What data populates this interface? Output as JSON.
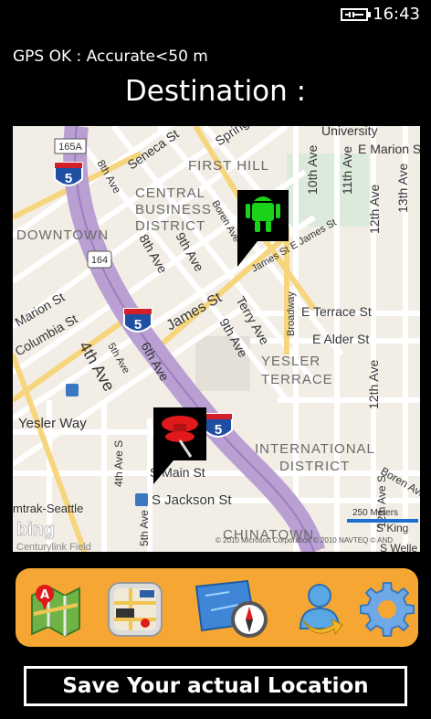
{
  "status_bar": {
    "time": "16:43",
    "battery_icon": "battery-charging-icon"
  },
  "gps_status": "GPS OK : Accurate<50 m",
  "destination_label": "Destination :",
  "map": {
    "labels": {
      "first_hill": "FIRST HILL",
      "central": "CENTRAL",
      "business": "BUSINESS",
      "district": "DISTRICT",
      "downtown": "DOWNTOWN",
      "seneca": "Seneca St",
      "spring": "Spring",
      "university": "University",
      "marion_e": "E Marion S",
      "ave10": "10th Ave",
      "ave11": "11th Ave",
      "ave12_top": "12th Ave",
      "ave13": "13th Ave",
      "ave8": "8th Ave",
      "ave9": "9th Ave",
      "boren": "Boren Ave",
      "james_e": "James St E James St",
      "james": "James St",
      "terry": "Terry Ave",
      "ave9b": "9th Ave",
      "broadway": "Broadway",
      "terrace_e": "E Terrace St",
      "alder_e": "E Alder St",
      "yesler_t1": "YESLER",
      "yesler_t2": "TERRACE",
      "ave12_mid": "12th Ave",
      "marion": "Marion St",
      "columbia": "Columbia St",
      "ave4": "4th Ave",
      "ave5": "5th Ave",
      "ave6": "6th Ave",
      "yesler_way": "Yesler Way",
      "ave4b": "4th Ave S",
      "ave5b": "5th Ave S",
      "main": "S Main St",
      "jackson": "S Jackson St",
      "intl1": "INTERNATIONAL",
      "intl2": "DISTRICT",
      "amtrak": "mtrak-Seattle",
      "chinatown": "CHINATOWN",
      "boren_s": "Boren Ave S",
      "ave12_low": "12th Ave S",
      "king": "S King",
      "weller": "S Welle",
      "bing": "bing",
      "scale": "250 Meters",
      "copyright": "© 2010 Microsoft Corporation   © 2010 NAVTEQ   © AND",
      "qwest": "Centurylink Field",
      "shield_165a": "165A",
      "shield_164": "164",
      "shield_5": "5"
    }
  },
  "apps": [
    {
      "name": "maps-app-icon"
    },
    {
      "name": "gps-navigation-icon"
    },
    {
      "name": "map-compass-icon"
    },
    {
      "name": "contact-share-icon"
    },
    {
      "name": "settings-gear-icon"
    }
  ],
  "save_button_label": "Save Your actual Location",
  "colors": {
    "app_bar": "#f6a733",
    "pin_green": "#19d219",
    "pin_red": "#e0191b",
    "highway": "#b99fd2"
  }
}
